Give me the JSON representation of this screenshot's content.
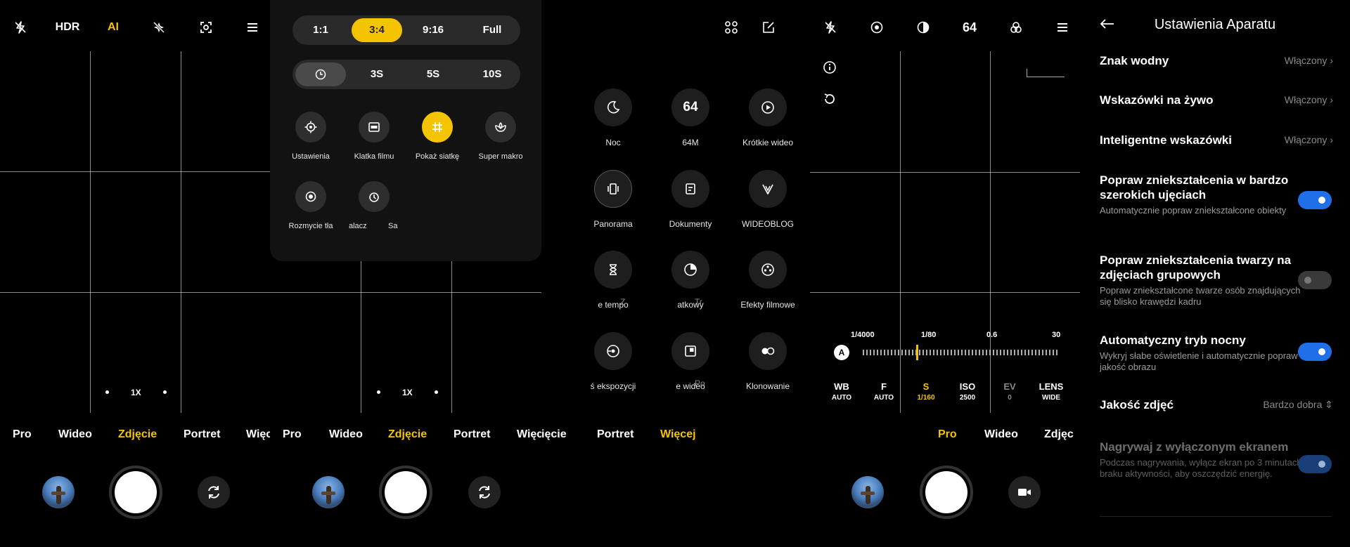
{
  "colors": {
    "accent": "#f5c400",
    "toggle_on": "#1f6fe8",
    "background": "#000000"
  },
  "panel1": {
    "topbar": {
      "hdr": "HDR",
      "ai": "AI"
    },
    "zoom": "1X",
    "modes": [
      "Pro",
      "Wideo",
      "Zdjęcie",
      "Portret",
      "Więc"
    ]
  },
  "panel2": {
    "ratios": [
      "1:1",
      "3:4",
      "9:16",
      "Full"
    ],
    "timers": [
      "3S",
      "5S",
      "10S"
    ],
    "options": [
      "Ustawienia",
      "Klatka filmu",
      "Pokaż siatkę",
      "Super makro",
      "Rozmycie tła",
      "alacz",
      "Sa"
    ],
    "zoom": "1X",
    "modes": [
      "Pro",
      "Wideo",
      "Zdjęcie",
      "Portret",
      "Więc"
    ]
  },
  "panel3": {
    "grid": [
      {
        "label": "Noc",
        "icon": "moon-icon"
      },
      {
        "label": "64M",
        "icon_text": "64"
      },
      {
        "label": "Krótkie wideo",
        "icon": "play-icon"
      },
      {
        "label": "Panorama",
        "icon": "panorama-icon"
      },
      {
        "label": "Dokumenty",
        "icon": "document-icon"
      },
      {
        "label": "WIDEOBLOG",
        "icon": "vlog-icon"
      },
      {
        "label": "e tempo",
        "extra": "Z",
        "icon": "hourglass-icon"
      },
      {
        "label": "atkowy",
        "extra": "Tr",
        "icon": "timer-icon"
      },
      {
        "label": "Efekty filmowe",
        "icon": "film-effects-icon"
      },
      {
        "label": "ś ekspozycji",
        "icon": "long-exposure-icon"
      },
      {
        "label": "e wideo",
        "extra": "Po",
        "icon": "dual-video-icon"
      },
      {
        "label": "Klonowanie",
        "icon": "clone-icon"
      }
    ],
    "modes": [
      "ięcie",
      "Portret",
      "Więcej"
    ]
  },
  "panel4": {
    "topbar": {
      "resolution": "64"
    },
    "scale_labels": [
      "1/4000",
      "1/80",
      "0.6",
      "30"
    ],
    "auto_badge": "A",
    "params": [
      {
        "k": "WB",
        "v": "AUTO"
      },
      {
        "k": "F",
        "v": "AUTO"
      },
      {
        "k": "S",
        "v": "1/160"
      },
      {
        "k": "ISO",
        "v": "2500"
      },
      {
        "k": "EV",
        "v": "0"
      },
      {
        "k": "LENS",
        "v": "WIDE"
      }
    ],
    "modes": [
      "Pro",
      "Wideo",
      "Zdjęc"
    ]
  },
  "settings": {
    "title": "Ustawienia Aparatu",
    "watermark": {
      "title": "Znak wodny",
      "value": "Włączony"
    },
    "live_tips": {
      "title": "Wskazówki na żywo",
      "value": "Włączony"
    },
    "smart_tips": {
      "title": "Inteligentne wskazówki",
      "value": "Włączony"
    },
    "ultrawide": {
      "title": "Popraw zniekształcenia w bardzo szerokich ujęciach",
      "sub": "Automatycznie popraw zniekształcone obiekty"
    },
    "face": {
      "title": "Popraw zniekształcenia twarzy na zdjęciach grupowych",
      "sub": "Popraw zniekształcone twarze osób znajdujących się blisko krawędzi kadru"
    },
    "night": {
      "title": "Automatyczny tryb nocny",
      "sub": "Wykryj słabe oświetlenie i automatycznie popraw jakość obrazu"
    },
    "quality": {
      "title": "Jakość zdjęć",
      "value": "Bardzo dobra"
    },
    "screen_off": {
      "title": "Nagrywaj z wyłączonym ekranem",
      "sub": "Podczas nagrywania, wyłącz ekran po 3 minutach braku aktywności, aby oszczędzić energię."
    }
  }
}
